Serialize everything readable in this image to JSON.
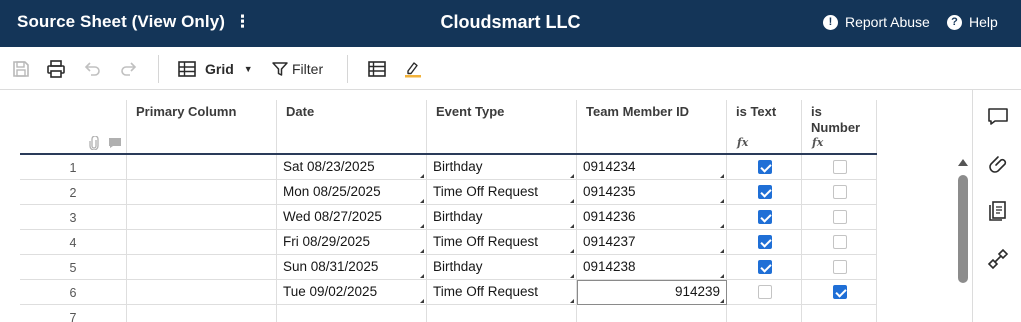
{
  "header": {
    "sheet_title": "Source Sheet (View Only)",
    "menu_glyph": "⋮",
    "org_name": "Cloudsmart LLC",
    "report_icon": "!",
    "report_label": "Report Abuse",
    "help_icon": "?",
    "help_label": "Help"
  },
  "toolbar": {
    "view_label": "Grid",
    "view_caret": "▼",
    "filter_label": "Filter",
    "icons": [
      "save-icon",
      "print-icon",
      "undo-icon",
      "redo-icon",
      "grid-view-icon",
      "filter-icon",
      "card-view-icon",
      "highlight-icon"
    ]
  },
  "grid": {
    "columns": [
      {
        "label": "Primary Column",
        "fx": ""
      },
      {
        "label": "Date",
        "fx": ""
      },
      {
        "label": "Event Type",
        "fx": ""
      },
      {
        "label": "Team Member ID",
        "fx": ""
      },
      {
        "label": "is Text",
        "fx": "fx"
      },
      {
        "label": "is Number",
        "fx": "fx"
      }
    ],
    "rows": [
      {
        "num": "1",
        "primary": "",
        "date": "Sat 08/23/2025",
        "event": "Birthday",
        "member": "0914234",
        "is_text": true,
        "is_number": false
      },
      {
        "num": "2",
        "primary": "",
        "date": "Mon 08/25/2025",
        "event": "Time Off Request",
        "member": "0914235",
        "is_text": true,
        "is_number": false
      },
      {
        "num": "3",
        "primary": "",
        "date": "Wed 08/27/2025",
        "event": "Birthday",
        "member": "0914236",
        "is_text": true,
        "is_number": false
      },
      {
        "num": "4",
        "primary": "",
        "date": "Fri 08/29/2025",
        "event": "Time Off Request",
        "member": "0914237",
        "is_text": true,
        "is_number": false
      },
      {
        "num": "5",
        "primary": "",
        "date": "Sun 08/31/2025",
        "event": "Birthday",
        "member": "0914238",
        "is_text": true,
        "is_number": false
      },
      {
        "num": "6",
        "primary": "",
        "date": "Tue 09/02/2025",
        "event": "Time Off Request",
        "member": "914239",
        "is_text": false,
        "is_number": true
      },
      {
        "num": "7",
        "primary": "",
        "date": "",
        "event": "",
        "member": "",
        "is_text": null,
        "is_number": null
      }
    ],
    "selected_row": 5,
    "selected_column": "member"
  },
  "right_rail": {
    "icons": [
      "comments-icon",
      "attachments-icon",
      "proofs-icon",
      "connections-icon"
    ]
  },
  "colors": {
    "header_bg": "#143558",
    "checkbox_on": "#1f6fd6",
    "header_rule": "#2a3b59"
  }
}
